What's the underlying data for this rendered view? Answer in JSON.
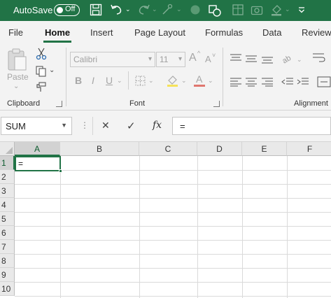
{
  "titlebar": {
    "autosave_label": "AutoSave",
    "autosave_state": "Off",
    "icons": [
      "save-icon",
      "undo-icon",
      "redo-icon",
      "format-painter-icon",
      "record-macro-icon",
      "shapes-icon",
      "table-icon",
      "camera-icon",
      "fill-color-icon",
      "customize-toolbar-icon"
    ]
  },
  "tabs": [
    {
      "label": "File",
      "active": false
    },
    {
      "label": "Home",
      "active": true
    },
    {
      "label": "Insert",
      "active": false
    },
    {
      "label": "Page Layout",
      "active": false
    },
    {
      "label": "Formulas",
      "active": false
    },
    {
      "label": "Data",
      "active": false
    },
    {
      "label": "Review",
      "active": false
    }
  ],
  "ribbon": {
    "clipboard": {
      "label": "Clipboard",
      "paste_label": "Paste"
    },
    "font": {
      "label": "Font",
      "font_name": "Calibri",
      "font_size": "11",
      "bold": "B",
      "italic": "I",
      "underline": "U",
      "font_color_letter": "A",
      "grow_letter": "A",
      "shrink_letter": "A"
    },
    "alignment": {
      "label": "Alignment"
    }
  },
  "formula_bar": {
    "name_box": "SUM",
    "cancel_symbol": "✕",
    "enter_symbol": "✓",
    "fx_label": "fx",
    "formula_value": "="
  },
  "grid": {
    "columns": [
      "A",
      "B",
      "C",
      "D",
      "E",
      "F"
    ],
    "rows": [
      "1",
      "2",
      "3",
      "4",
      "5",
      "6",
      "7",
      "8",
      "9",
      "10"
    ],
    "active_cell_value": "="
  },
  "colors": {
    "accent": "#217346",
    "ribbon_bg": "#f3f3f3"
  }
}
